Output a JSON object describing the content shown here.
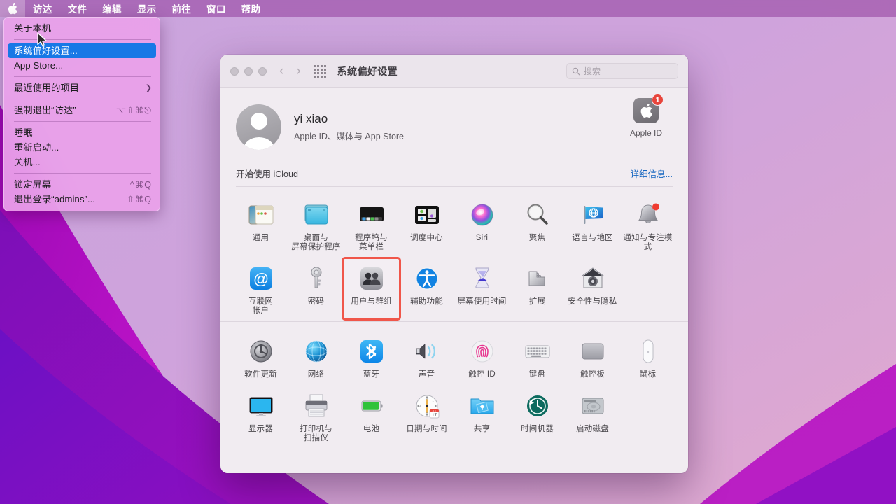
{
  "menubar": {
    "apple_icon": "apple-logo-icon",
    "items": [
      "访达",
      "文件",
      "编辑",
      "显示",
      "前往",
      "窗口",
      "帮助"
    ]
  },
  "apple_menu": {
    "groups": [
      [
        {
          "label": "关于本机",
          "shortcut": "",
          "selected": false,
          "submenu": false
        }
      ],
      [
        {
          "label": "系统偏好设置...",
          "shortcut": "",
          "selected": true,
          "submenu": false
        },
        {
          "label": "App Store...",
          "shortcut": "",
          "selected": false,
          "submenu": false
        }
      ],
      [
        {
          "label": "最近使用的项目",
          "shortcut": "",
          "selected": false,
          "submenu": true
        }
      ],
      [
        {
          "label": "强制退出“访达”",
          "shortcut": "⌥⇧⌘⎋",
          "selected": false,
          "submenu": false
        }
      ],
      [
        {
          "label": "睡眠",
          "shortcut": "",
          "selected": false,
          "submenu": false
        },
        {
          "label": "重新启动...",
          "shortcut": "",
          "selected": false,
          "submenu": false
        },
        {
          "label": "关机...",
          "shortcut": "",
          "selected": false,
          "submenu": false
        }
      ],
      [
        {
          "label": "锁定屏幕",
          "shortcut": "^⌘Q",
          "selected": false,
          "submenu": false
        },
        {
          "label": "退出登录“admins”...",
          "shortcut": "⇧⌘Q",
          "selected": false,
          "submenu": false
        }
      ]
    ]
  },
  "window": {
    "title": "系统偏好设置",
    "traffic_lights": [
      "close-button",
      "minimize-button",
      "zoom-button"
    ],
    "back_label": "‹",
    "forward_label": "›",
    "grid_button": "show-all-icon",
    "search": {
      "placeholder": "搜索",
      "value": "",
      "icon": "search-icon"
    }
  },
  "apple_id": {
    "user_name": "yi xiao",
    "user_subtitle": "Apple ID、媒体与 App Store",
    "button_label": "Apple ID",
    "badge_count": "1",
    "avatar": "user-avatar"
  },
  "icloud_banner": {
    "label": "开始使用 iCloud",
    "more_link": "详细信息..."
  },
  "prefs_section_1": [
    {
      "id": "general",
      "label": "通用",
      "icon": "general-icon"
    },
    {
      "id": "desktop",
      "label": "桌面与\n屏幕保护程序",
      "icon": "desktop-screensaver-icon"
    },
    {
      "id": "dock",
      "label": "程序坞与\n菜单栏",
      "icon": "dock-menubar-icon"
    },
    {
      "id": "mission",
      "label": "调度中心",
      "icon": "mission-control-icon"
    },
    {
      "id": "siri",
      "label": "Siri",
      "icon": "siri-icon"
    },
    {
      "id": "spotlight",
      "label": "聚焦",
      "icon": "spotlight-icon"
    },
    {
      "id": "language",
      "label": "语言与地区",
      "icon": "language-region-icon"
    },
    {
      "id": "notifications",
      "label": "通知与专注模式",
      "icon": "notifications-focus-icon"
    },
    {
      "id": "internet",
      "label": "互联网\n帐户",
      "icon": "internet-accounts-icon"
    },
    {
      "id": "passwords",
      "label": "密码",
      "icon": "passwords-key-icon"
    },
    {
      "id": "users",
      "label": "用户与群组",
      "icon": "users-groups-icon",
      "highlighted": true
    },
    {
      "id": "accessibility",
      "label": "辅助功能",
      "icon": "accessibility-icon"
    },
    {
      "id": "screentime",
      "label": "屏幕使用时间",
      "icon": "screen-time-icon"
    },
    {
      "id": "extensions",
      "label": "扩展",
      "icon": "extensions-puzzle-icon"
    },
    {
      "id": "security",
      "label": "安全性与隐私",
      "icon": "security-privacy-icon"
    }
  ],
  "prefs_section_2": [
    {
      "id": "softwareupdate",
      "label": "软件更新",
      "icon": "software-update-icon"
    },
    {
      "id": "network",
      "label": "网络",
      "icon": "network-globe-icon"
    },
    {
      "id": "bluetooth",
      "label": "蓝牙",
      "icon": "bluetooth-icon"
    },
    {
      "id": "sound",
      "label": "声音",
      "icon": "sound-speaker-icon"
    },
    {
      "id": "touchid",
      "label": "触控 ID",
      "icon": "touch-id-icon"
    },
    {
      "id": "keyboard",
      "label": "键盘",
      "icon": "keyboard-icon"
    },
    {
      "id": "trackpad",
      "label": "触控板",
      "icon": "trackpad-icon"
    },
    {
      "id": "mouse",
      "label": "鼠标",
      "icon": "mouse-icon"
    },
    {
      "id": "displays",
      "label": "显示器",
      "icon": "displays-icon"
    },
    {
      "id": "printers",
      "label": "打印机与\n扫描仪",
      "icon": "printers-scanners-icon"
    },
    {
      "id": "battery",
      "label": "电池",
      "icon": "battery-icon"
    },
    {
      "id": "datetime",
      "label": "日期与时间",
      "icon": "date-time-icon",
      "clock_month": "JUL",
      "clock_day": "17"
    },
    {
      "id": "sharing",
      "label": "共享",
      "icon": "sharing-folder-icon"
    },
    {
      "id": "timemachine",
      "label": "时间机器",
      "icon": "time-machine-icon"
    },
    {
      "id": "startupdisk",
      "label": "启动磁盘",
      "icon": "startup-disk-icon"
    }
  ],
  "colors": {
    "menu_highlight": "#1878e6",
    "highlight_box": "#f0564a",
    "badge_red": "#e8453c",
    "link_blue": "#1465c0",
    "window_bg": "#f1ecf1",
    "titlebar_bg": "#ebe5ec"
  }
}
